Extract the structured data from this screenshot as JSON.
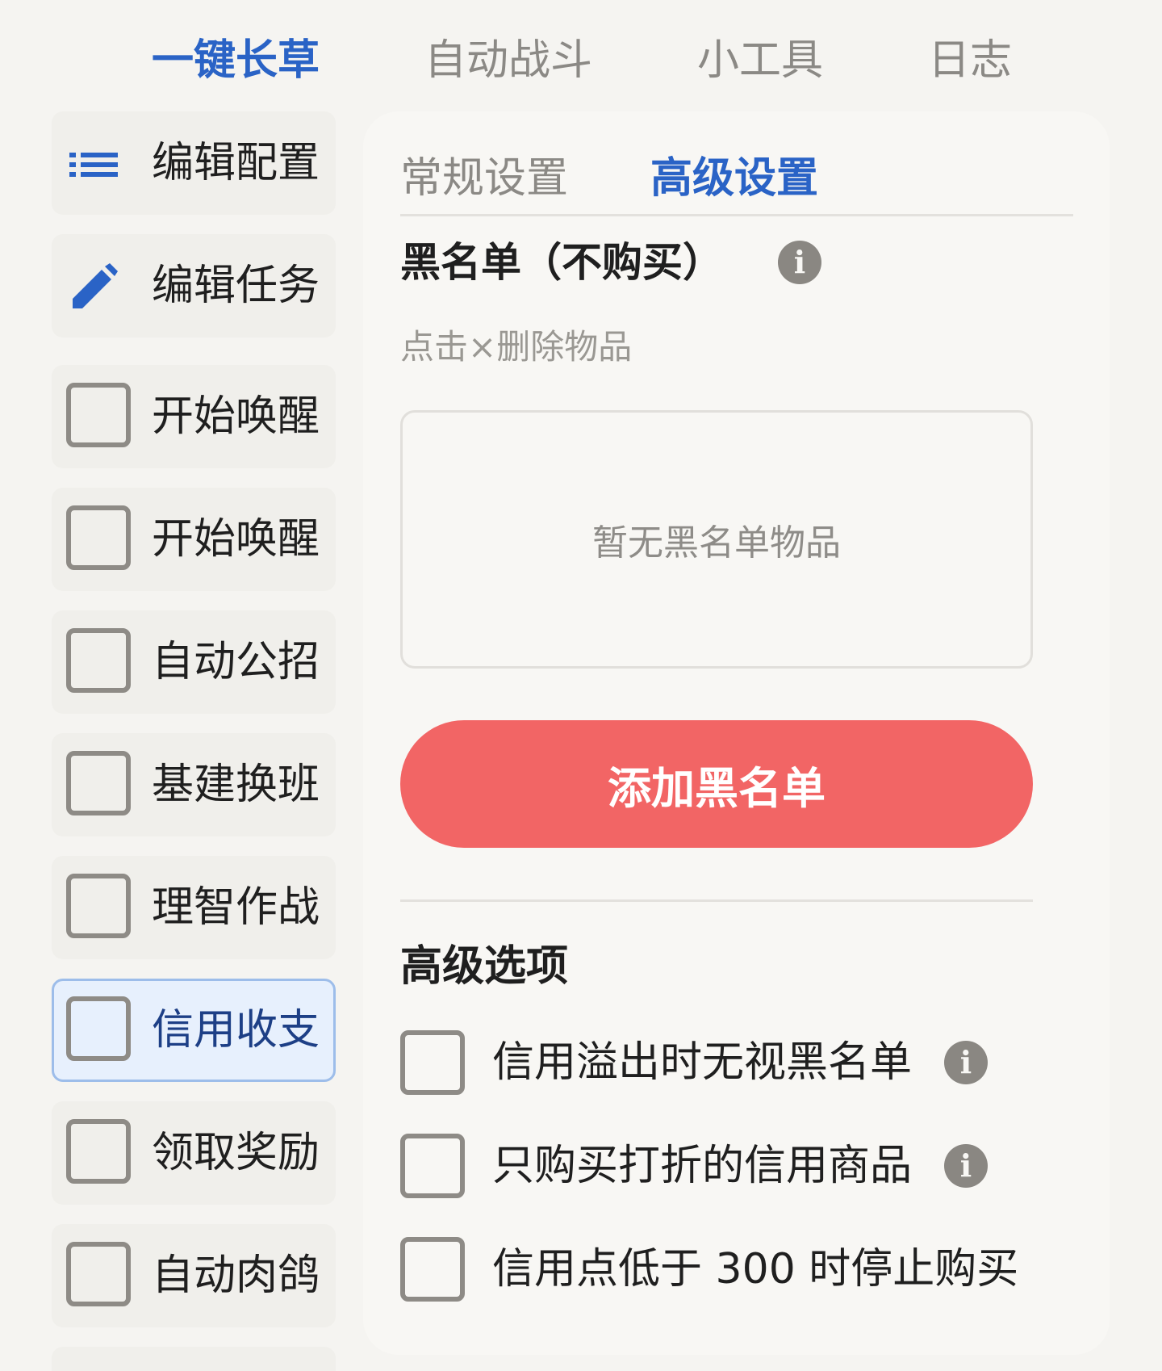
{
  "top_nav": {
    "tabs": [
      {
        "label": "一键长草",
        "active": true
      },
      {
        "label": "自动战斗",
        "active": false
      },
      {
        "label": "小工具",
        "active": false
      },
      {
        "label": "日志",
        "active": false
      }
    ]
  },
  "sidebar": {
    "items": [
      {
        "label": "编辑配置",
        "icon": "list-icon"
      },
      {
        "label": "编辑任务",
        "icon": "pencil-icon"
      },
      {
        "label": "开始唤醒",
        "checked": false
      },
      {
        "label": "开始唤醒",
        "checked": false
      },
      {
        "label": "自动公招",
        "checked": false
      },
      {
        "label": "基建换班",
        "checked": false
      },
      {
        "label": "理智作战",
        "checked": false
      },
      {
        "label": "信用收支",
        "checked": false,
        "selected": true
      },
      {
        "label": "领取奖励",
        "checked": false
      },
      {
        "label": "自动肉鸽",
        "checked": false
      }
    ]
  },
  "panel": {
    "sub_tabs": [
      {
        "label": "常规设置",
        "active": false
      },
      {
        "label": "高级设置",
        "active": true
      }
    ],
    "blacklist": {
      "title": "黑名单（不购买）",
      "hint": "点击×删除物品",
      "empty_text": "暂无黑名单物品",
      "add_button": "添加黑名单"
    },
    "advanced": {
      "title": "高级选项",
      "options": [
        {
          "label": "信用溢出时无视黑名单",
          "checked": false,
          "info": true
        },
        {
          "label": "只购买打折的信用商品",
          "checked": false,
          "info": true
        },
        {
          "label": "信用点低于 300 时停止购买",
          "checked": false,
          "info": false
        }
      ]
    },
    "info_icon_glyph": "i"
  },
  "colors": {
    "accent": "#2a63c6",
    "danger_button": "#f26565",
    "background": "#f5f4f1",
    "selected_bg": "#e7f0fd"
  }
}
